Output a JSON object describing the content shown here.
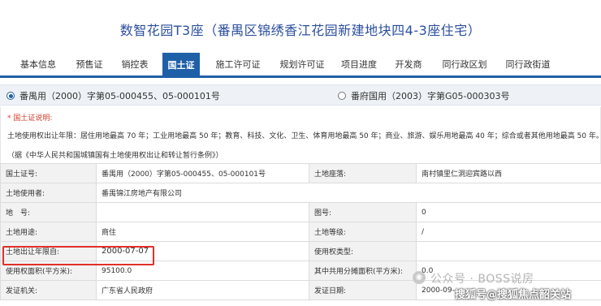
{
  "page_title": "数智花园T3座（番禺区锦绣香江花园新建地块四4-3座住宅）",
  "tabs": [
    "基本信息",
    "预售证",
    "销控表",
    "国土证",
    "施工许可证",
    "规划许可证",
    "项目进度",
    "开发商",
    "同行政区划",
    "同行政街道"
  ],
  "active_tab": "国土证",
  "certificates": [
    {
      "label": "番禺用（2000）字第05-000455、05-000101号",
      "selected": true
    },
    {
      "label": "番府国用（2003）字第G05-000303号",
      "selected": false
    }
  ],
  "notes": {
    "heading": "* 国土证说明:",
    "line1": "土地使用权出让年限：居住用地最高 70 年；工业用地最高 50 年；教育、科技、文化、卫生、体育用地最高 50 年；商业、旅游、娱乐用地最高 40 年；综合或者其他用地最高 50 年。",
    "line2": "（据《中华人民共和国城镇国有土地使用权出让和转让暂行条例》）"
  },
  "fields": {
    "cert_no_label": "国土证号:",
    "cert_no": "番禺用（2000）字第05-000455、05-000101号",
    "location_label": "土地座落:",
    "location": "南村镇里仁洞迎宾路以西",
    "user_label": "土地使用者:",
    "user": "番禺锦江房地产有限公司",
    "lot_label": "地　号:",
    "lot": "",
    "map_label": "图号:",
    "map": "0",
    "usage_label": "土地用途:",
    "usage": "商住",
    "grade_label": "土地等级:",
    "grade": "/",
    "term_label": "土地出让年限自:",
    "term": "2000-07-07",
    "right_type_label": "使用权类型:",
    "right_type": "",
    "area_label": "使用权面积(平方米):",
    "area": "95100.0",
    "shared_label": "其中共用分摊面积(平方米):",
    "shared": "0.0",
    "issuer_label": "发证机关:",
    "issuer": "广东省人民政府",
    "date_label": "发证日期:",
    "date": "2000-09-"
  },
  "watermark": {
    "line1": "公众号 · BOSS说房",
    "line2": "搜狐号@搜狐焦点韶关站"
  },
  "colors": {
    "accent": "#1f5fa8",
    "title": "#2c4f9e",
    "highlight": "#e0302a"
  }
}
